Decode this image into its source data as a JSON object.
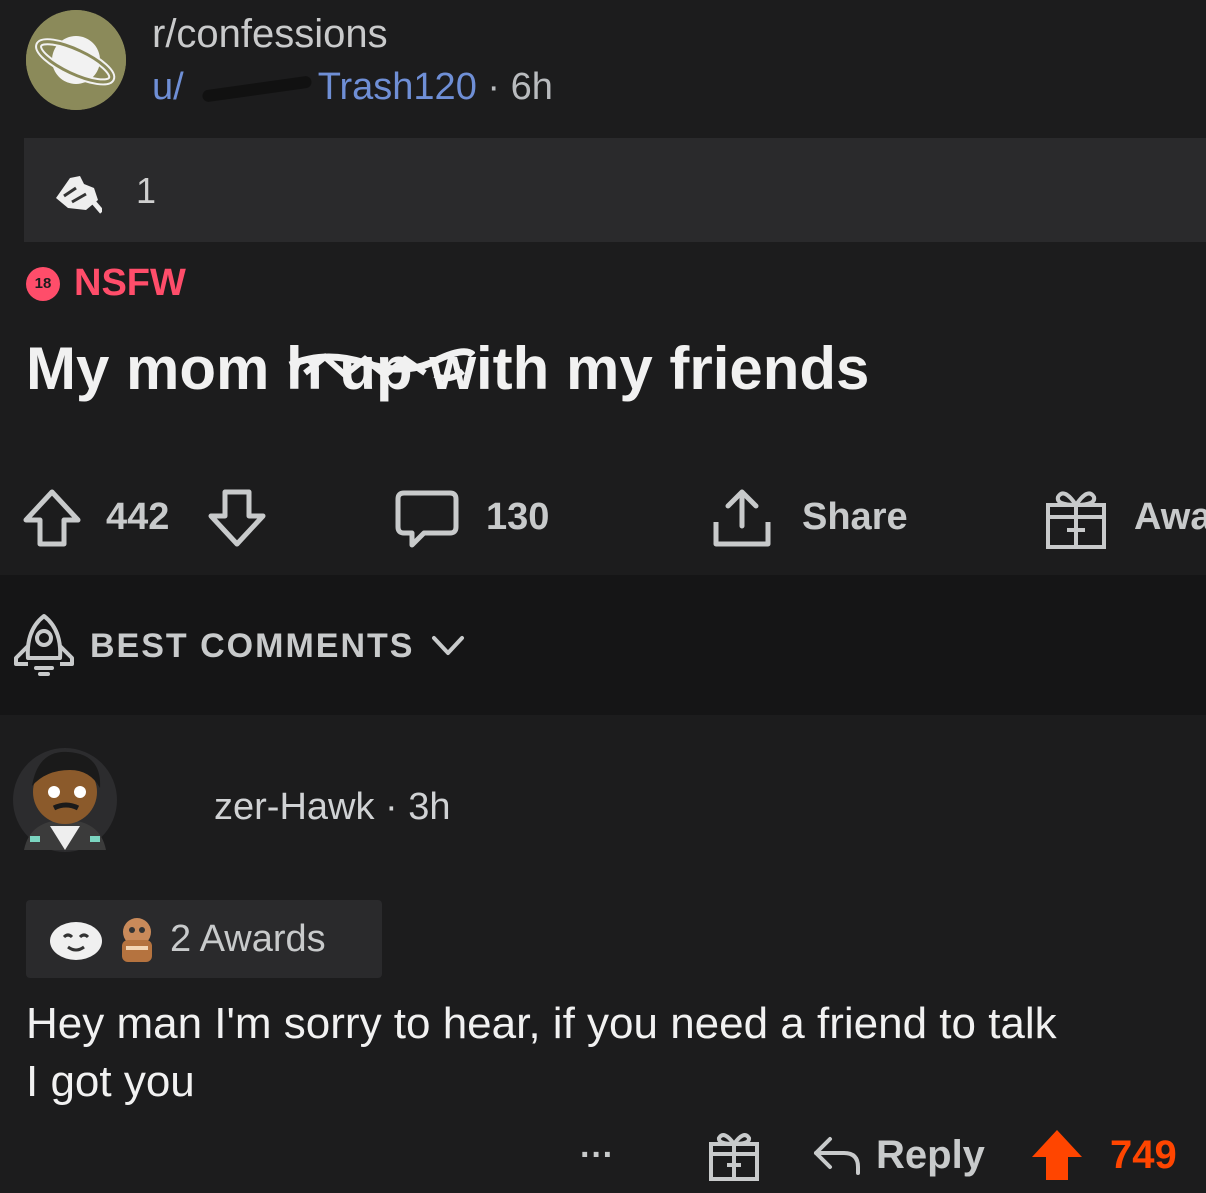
{
  "post": {
    "subreddit": "r/confessions",
    "user_prefix": "u/",
    "username": "Trash120",
    "time": "· 6h",
    "award_count": "1",
    "nsfw_badge": "18",
    "nsfw_label": "NSFW",
    "title": "My mom h    up with my friends",
    "upvotes": "442",
    "comments": "130",
    "share_label": "Share",
    "award_label": "Awa"
  },
  "sort": {
    "label": "BEST COMMENTS"
  },
  "comment": {
    "username": "zer-Hawk",
    "time": "· 3h",
    "awards_label": "2 Awards",
    "text_line1": "Hey man I'm sorry to hear, if you need a friend to talk",
    "text_line2": "I got you",
    "more_label": "···",
    "reply_label": "Reply",
    "score": "749",
    "score_color": "#ff4500"
  },
  "icons": [
    "subreddit-planet-icon",
    "wholesome-award-icon",
    "upvote-icon",
    "downvote-icon",
    "comment-icon",
    "share-icon",
    "gift-award-icon",
    "rocket-sort-icon",
    "chevron-down-icon",
    "reply-icon",
    "more-icon"
  ]
}
